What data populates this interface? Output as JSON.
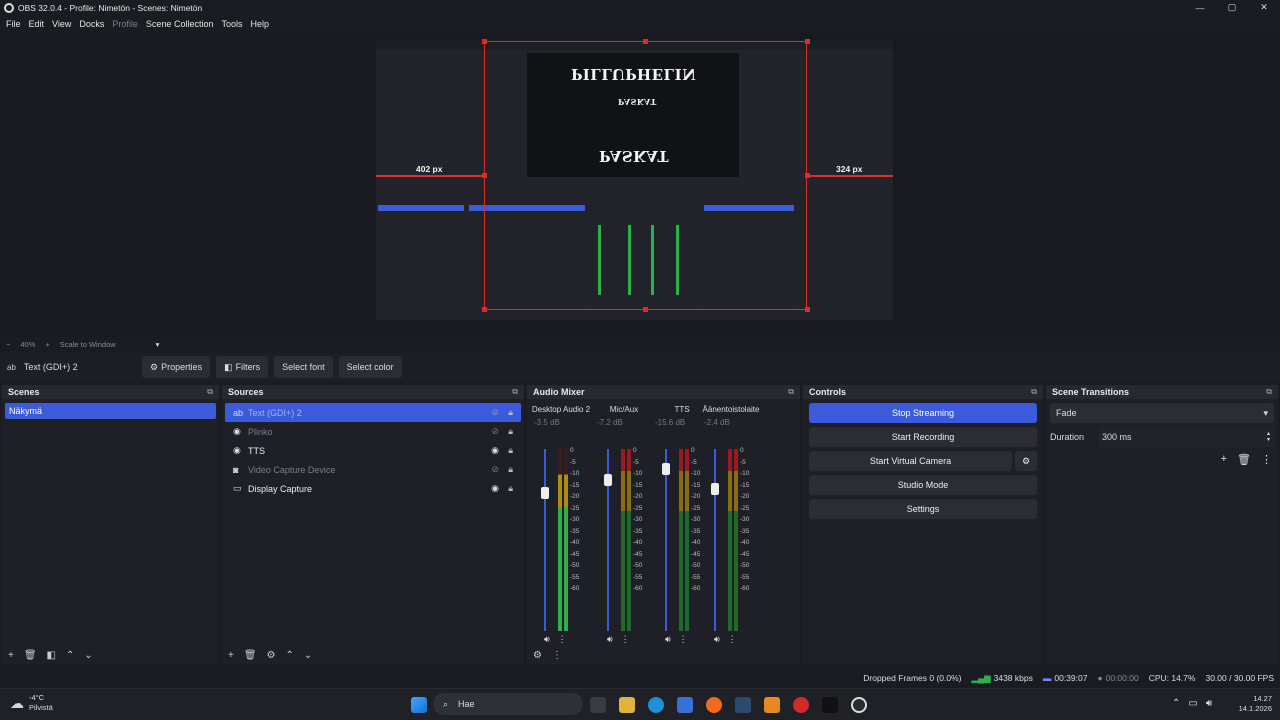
{
  "window": {
    "title": "OBS 32.0.4 - Profile: Nimetön - Scenes: Nimetön",
    "min": "—",
    "max": "▢",
    "close": "✕"
  },
  "menu": [
    "File",
    "Edit",
    "View",
    "Docks",
    "Profile",
    "Scene Collection",
    "Tools",
    "Help"
  ],
  "preview": {
    "left_px": "402 px",
    "right_px": "324 px",
    "overlay_top": "PILLUPHELIN",
    "overlay_bottom": "PASKAT",
    "overlay_small": "PASKAT"
  },
  "zoom": {
    "minus": "−",
    "level": "40%",
    "plus": "+",
    "mode": "Scale to Window",
    "arrow": "▾"
  },
  "source_toolbar": {
    "source_name": "Text (GDI+) 2",
    "properties": "Properties",
    "filters": "Filters",
    "select_font": "Select font",
    "select_color": "Select color"
  },
  "scenes": {
    "title": "Scenes",
    "items": [
      "Näkymä"
    ]
  },
  "sources": {
    "title": "Sources",
    "items": [
      {
        "label": "Text (GDI+) 2",
        "icon": "ab"
      },
      {
        "label": "Plinko",
        "icon": "◉"
      },
      {
        "label": "TTS",
        "icon": "◉"
      },
      {
        "label": "Video Capture Device",
        "icon": "◙"
      },
      {
        "label": "Display Capture",
        "icon": "▭"
      }
    ]
  },
  "audio_mixer": {
    "title": "Audio Mixer",
    "channels": [
      {
        "name": "Desktop Audio 2",
        "db": "-3.5 dB",
        "level": 0.58
      },
      {
        "name": "Mic/Aux",
        "db": "-7.2 dB",
        "level": 0.72
      },
      {
        "name": "TTS",
        "db": "-15.6 dB",
        "level": 0.85
      },
      {
        "name": "Äänentoistolaite",
        "db": "-2.4 dB",
        "level": 0.62
      }
    ],
    "scale": [
      "0",
      "-5",
      "-10",
      "-15",
      "-20",
      "-25",
      "-30",
      "-35",
      "-40",
      "-45",
      "-50",
      "-55",
      "-60"
    ]
  },
  "controls": {
    "title": "Controls",
    "stop_streaming": "Stop Streaming",
    "start_recording": "Start Recording",
    "start_virtual_camera": "Start Virtual Camera",
    "studio_mode": "Studio Mode",
    "settings": "Settings"
  },
  "transitions": {
    "title": "Scene Transitions",
    "type": "Fade",
    "duration_label": "Duration",
    "duration_value": "300 ms"
  },
  "status": {
    "dropped": "Dropped Frames 0 (0.0%)",
    "bitrate": "3438 kbps",
    "stream_time": "00:39:07",
    "rec_time": "00:00:00",
    "cpu": "CPU: 14.7%",
    "fps": "30.00 / 30.00 FPS"
  },
  "taskbar": {
    "weather_temp": "-4°C",
    "weather_desc": "Pilvistä",
    "search": "Hae",
    "time": "14.27",
    "date": "14.1.2026"
  },
  "colors": {
    "accent": "#3b5bdb",
    "guide": "#e02a2a"
  }
}
